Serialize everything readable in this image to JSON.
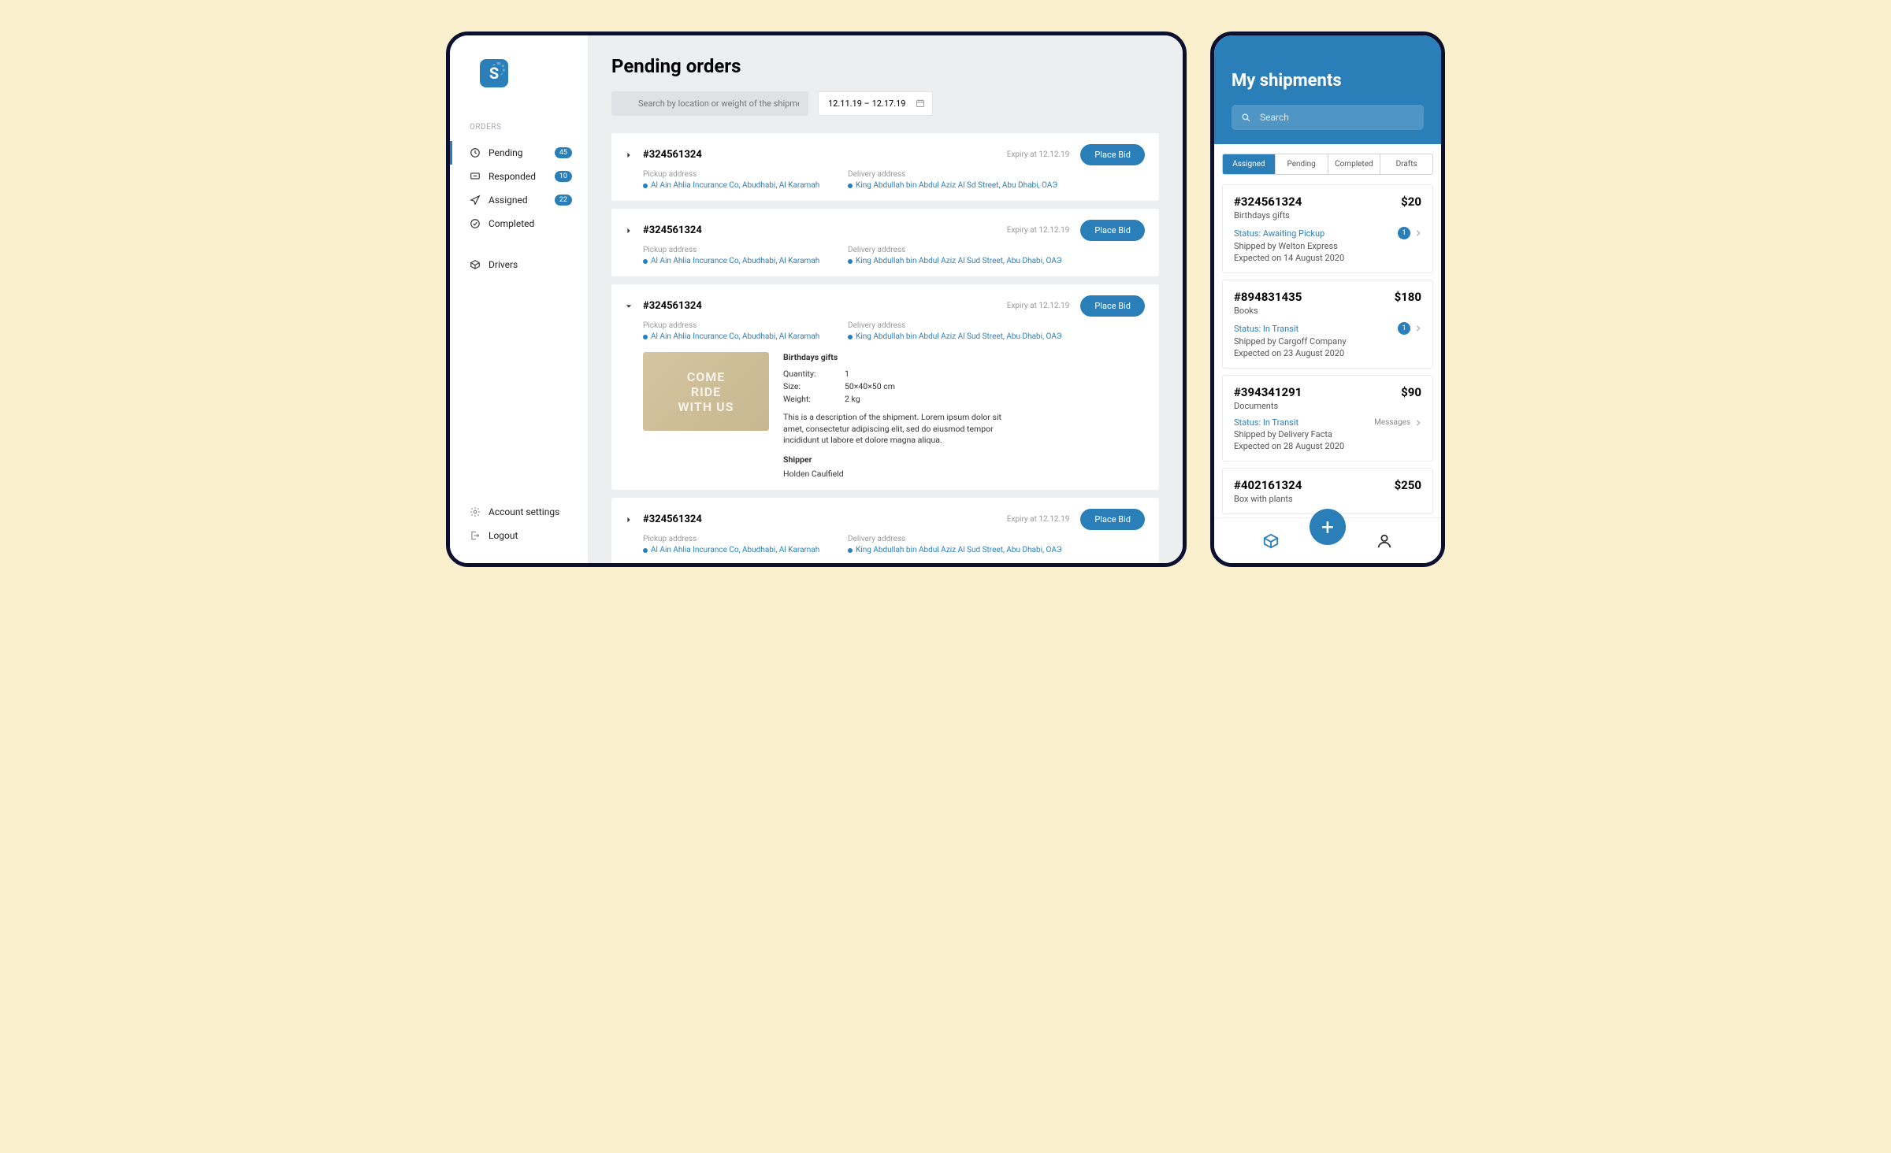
{
  "desktop": {
    "title": "Pending orders",
    "search": {
      "placeholder": "Search by location or weight of the shipment"
    },
    "date_range": "12.11.19 – 12.17.19",
    "sidebar": {
      "section": "ORDERS",
      "items": [
        {
          "label": "Pending",
          "badge": "45"
        },
        {
          "label": "Responded",
          "badge": "10"
        },
        {
          "label": "Assigned",
          "badge": "22"
        },
        {
          "label": "Completed"
        }
      ],
      "drivers": "Drivers",
      "account": "Account settings",
      "logout": "Logout"
    },
    "orders": [
      {
        "id": "#324561324",
        "expiry": "Expiry at 12.12.19",
        "pickup_label": "Pickup address",
        "pickup": "Al Ain Ahlia Incurance Co, Abudhabi, Al Karamah",
        "delivery_label": "Delivery address",
        "delivery": "King Abdullah bin Abdul Aziz Al Sd Street, Abu Dhabi, ОАЭ",
        "cta": "Place Bid"
      },
      {
        "id": "#324561324",
        "expiry": "Expiry at 12.12.19",
        "pickup_label": "Pickup address",
        "pickup": "Al Ain Ahlia Incurance Co, Abudhabi, Al Karamah",
        "delivery_label": "Delivery address",
        "delivery": "King Abdullah bin Abdul Aziz Al Sud Street, Abu Dhabi, ОАЭ",
        "cta": "Place Bid"
      },
      {
        "id": "#324561324",
        "expiry": "Expiry at 12.12.19",
        "pickup_label": "Pickup address",
        "pickup": "Al Ain Ahlia Incurance Co, Abudhabi, Al Karamah",
        "delivery_label": "Delivery address",
        "delivery": "King Abdullah bin Abdul Aziz Al Sud Street, Abu Dhabi, ОАЭ",
        "cta": "Place Bid",
        "expanded": {
          "title": "Birthdays gifts",
          "qty_label": "Quantity:",
          "qty": "1",
          "size_label": "Size:",
          "size": "50×40×50 cm",
          "weight_label": "Weight:",
          "weight": "2 kg",
          "desc": "This is a description of the shipment. Lorem ipsum dolor sit amet, consectetur adipiscing elit, sed do eiusmod tempor incididunt ut labore et dolore magna aliqua.",
          "shipper_label": "Shipper",
          "shipper": "Holden Caulfield"
        }
      },
      {
        "id": "#324561324",
        "expiry": "Expiry at 12.12.19",
        "pickup_label": "Pickup address",
        "pickup": "Al Ain Ahlia Incurance Co, Abudhabi, Al Karamah",
        "delivery_label": "Delivery address",
        "delivery": "King Abdullah bin Abdul Aziz Al Sud Street, Abu Dhabi, ОАЭ",
        "cta": "Place Bid"
      }
    ]
  },
  "mobile": {
    "title": "My shipments",
    "search_placeholder": "Search",
    "tabs": [
      "Assigned",
      "Pending",
      "Completed",
      "Drafts"
    ],
    "shipments": [
      {
        "id": "#324561324",
        "price": "$20",
        "sub": "Birthdays gifts",
        "status": "Status: Awaiting Pickup",
        "shipped": "Shipped by Welton Express",
        "expected": "Expected on 14 August 2020",
        "badge": "1"
      },
      {
        "id": "#894831435",
        "price": "$180",
        "sub": "Books",
        "status": "Status: In Transit",
        "shipped": "Shipped by Cargoff Company",
        "expected": "Expected on 23 August 2020",
        "badge": "1"
      },
      {
        "id": "#394341291",
        "price": "$90",
        "sub": "Documents",
        "status": "Status: In Transit",
        "shipped": "Shipped by Delivery Facta",
        "expected": "Expected on 28 August 2020",
        "msg": "Messages"
      },
      {
        "id": "#402161324",
        "price": "$250",
        "sub": "Box with plants"
      }
    ]
  }
}
